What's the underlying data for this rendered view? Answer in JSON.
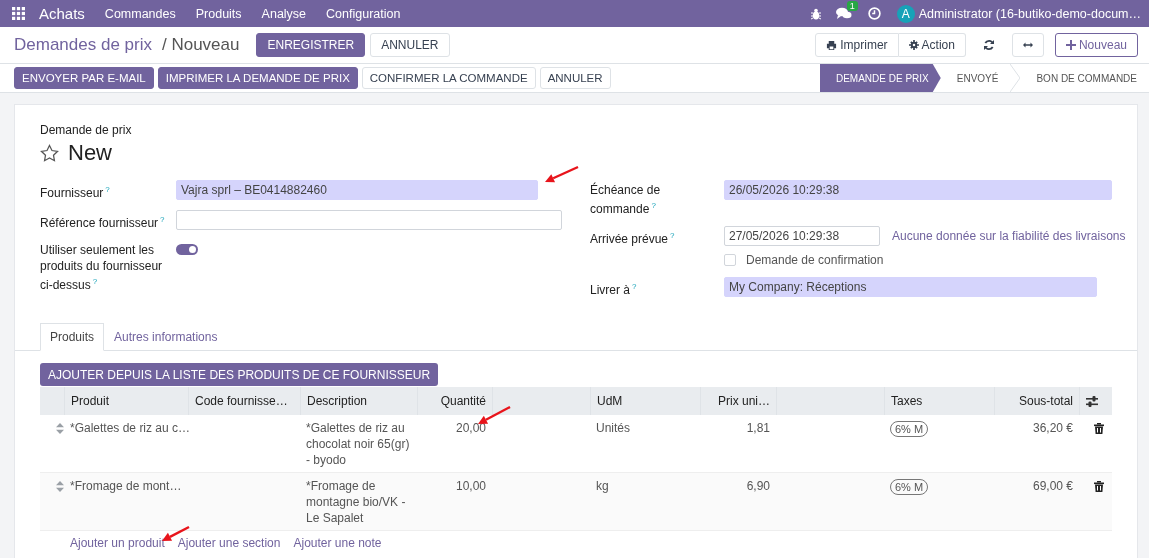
{
  "navbar": {
    "app_name": "Achats",
    "menu": [
      "Commandes",
      "Produits",
      "Analyse",
      "Configuration"
    ],
    "chat_badge": "1",
    "user_initial": "A",
    "user_name": "Administrator (16-butiko-demo-docum…"
  },
  "control_panel": {
    "breadcrumb": "Demandes de prix",
    "current": "/ Nouveau",
    "save": "ENREGISTRER",
    "discard": "ANNULER",
    "print": "Imprimer",
    "action": "Action",
    "new": "Nouveau"
  },
  "statusbar": {
    "actions": [
      {
        "label": "ENVOYER PAR E-MAIL",
        "primary": true
      },
      {
        "label": "IMPRIMER LA DEMANDE DE PRIX",
        "primary": true
      },
      {
        "label": "CONFIRMER LA COMMANDE",
        "primary": false
      },
      {
        "label": "ANNULER",
        "primary": false
      }
    ],
    "stages": [
      {
        "label": "DEMANDE DE PRIX",
        "selected": true
      },
      {
        "label": "ENVOYÉ",
        "selected": false
      },
      {
        "label": "BON DE COMMANDE",
        "selected": false
      }
    ]
  },
  "form": {
    "record_type": "Demande de prix",
    "title": "New",
    "starred": false,
    "left_fields": [
      {
        "kind": "input",
        "label": "Fournisseur",
        "tooltip": "?",
        "value": "Vajra sprl – BE0414882460",
        "required": true
      },
      {
        "kind": "input",
        "label": "Référence fournisseur",
        "tooltip": "?",
        "required": false
      },
      {
        "kind": "toggle",
        "label": "Utiliser seulement les produits du fournisseur ci-dessus",
        "tooltip": "?",
        "on": true
      }
    ],
    "right_fields": [
      {
        "kind": "input",
        "label": "Échéance de commande",
        "tooltip": "?",
        "value": "26/05/2026 10:29:38",
        "required": true
      },
      {
        "kind": "input",
        "label": "Arrivée prévue",
        "tooltip": "?",
        "value": "27/05/2026 10:29:38",
        "required": false,
        "note": "Aucune donnée sur la fiabilité des livraisons"
      },
      {
        "kind": "checkbox",
        "text": "Demande de confirmation",
        "checked": false
      },
      {
        "kind": "input",
        "label": "Livrer à",
        "tooltip": "?",
        "value": "My Company: Réceptions",
        "required": true
      }
    ]
  },
  "tabs": [
    {
      "label": "Produits",
      "selected": true
    },
    {
      "label": "Autres informations",
      "selected": false
    }
  ],
  "add_button": "AJOUTER DEPUIS LA LISTE DES PRODUITS DE CE FOURNISSEUR",
  "table": {
    "columns": [
      "Produit",
      "Code fournisse…",
      "Description",
      "Quantité",
      "UdM",
      "Prix uni…",
      "Taxes",
      "Sous-total"
    ],
    "rows": [
      {
        "product": "*Galettes de riz au c…",
        "description": "*Galettes de riz au chocolat noir 65(gr) - byodo",
        "quantity": "20,00",
        "uom": "Unités",
        "price": "1,81",
        "tax": "6% M",
        "subtotal": "36,20 €"
      },
      {
        "product": "*Fromage de mont…",
        "description": "*Fromage de montagne bio/VK - Le Sapalet",
        "quantity": "10,00",
        "uom": "kg",
        "price": "6,90",
        "tax": "6% M",
        "subtotal": "69,00 €"
      }
    ],
    "footer_links": [
      "Ajouter un produit",
      "Ajouter une section",
      "Ajouter une note"
    ]
  }
}
